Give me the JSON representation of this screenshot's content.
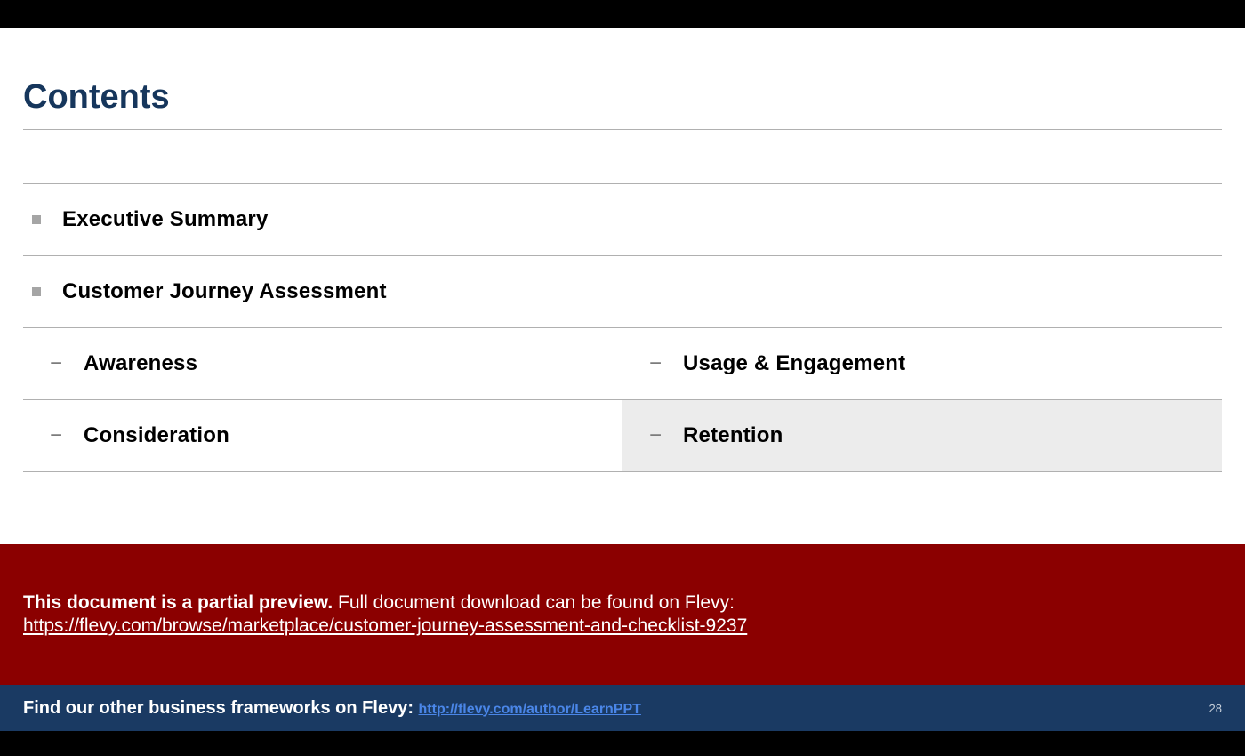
{
  "title": "Contents",
  "items": {
    "exec_summary": "Executive Summary",
    "cja": "Customer Journey Assessment",
    "awareness": "Awareness",
    "usage": "Usage & Engagement",
    "consideration": "Consideration",
    "retention": "Retention"
  },
  "banner": {
    "bold": "This document is a partial preview.",
    "rest": "  Full document download can be found on Flevy:",
    "link": "https://flevy.com/browse/marketplace/customer-journey-assessment-and-checklist-9237"
  },
  "footer": {
    "text": "Find our other business frameworks on Flevy: ",
    "link": "http://flevy.com/author/LearnPPT",
    "page": "28"
  }
}
